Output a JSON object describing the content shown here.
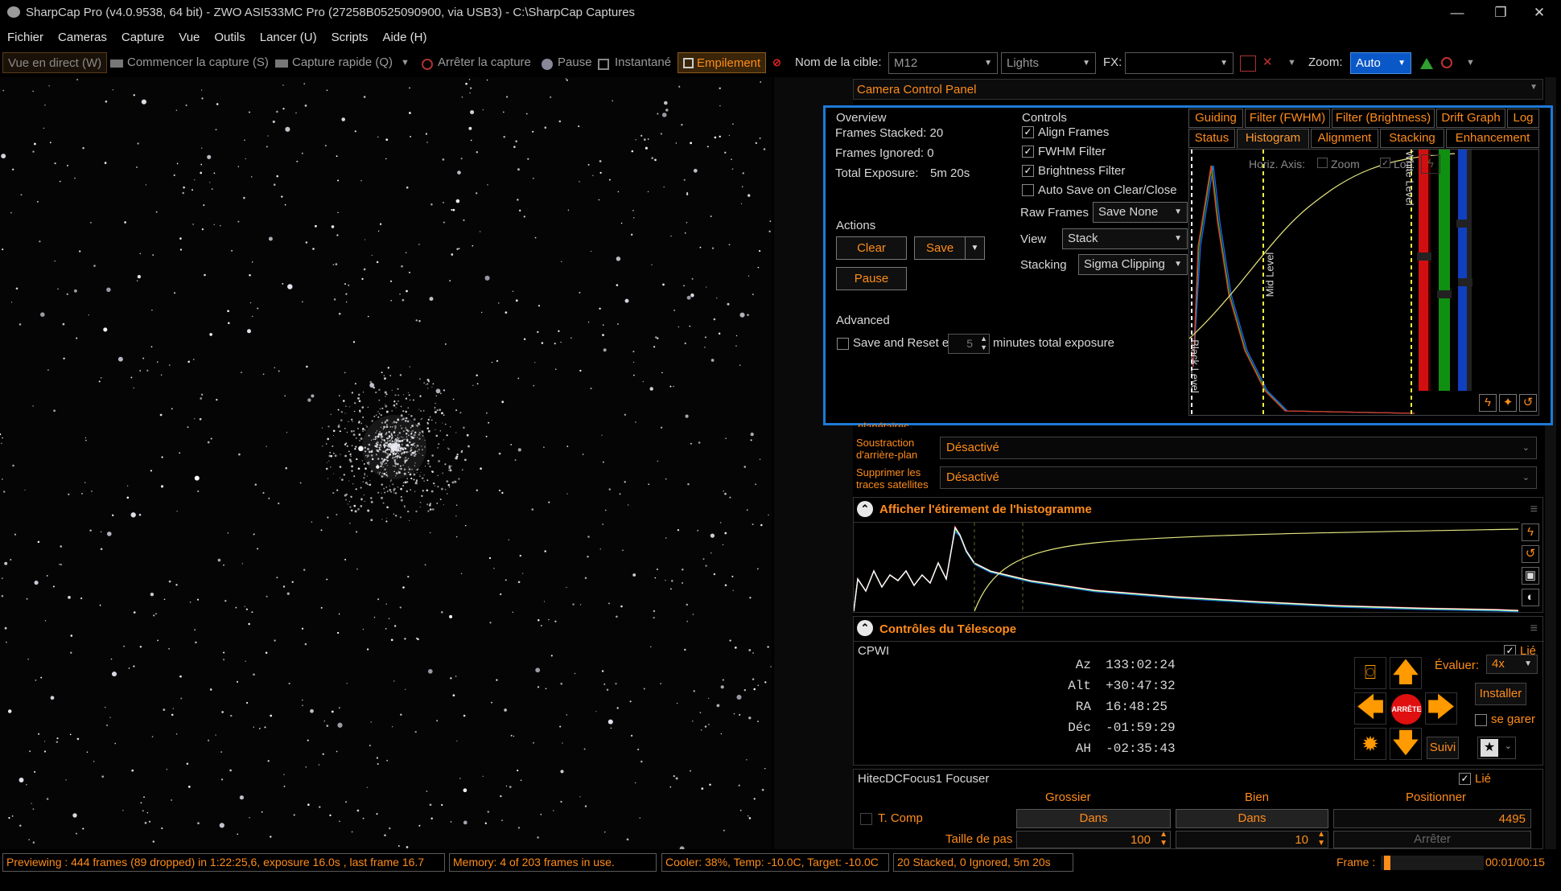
{
  "window": {
    "title": "SharpCap Pro (v4.0.9538, 64 bit) - ZWO ASI533MC Pro (27258B0525090900, via USB3) - C:\\SharpCap Captures",
    "minimize": "—",
    "restore": "❐",
    "close": "✕"
  },
  "menu": [
    "Fichier",
    "Cameras",
    "Capture",
    "Vue",
    "Outils",
    "Lancer (U)",
    "Scripts",
    "Aide (H)"
  ],
  "toolbar": {
    "live_view": "Vue en direct (W)",
    "start_capture": "Commencer la capture (S)",
    "quick_capture": "Capture rapide (Q)",
    "stop_capture": "Arrêter la capture",
    "pause": "Pause",
    "snapshot": "Instantané",
    "stack": "Empilement",
    "target_label": "Nom de la cible:",
    "target_value": "M12",
    "frame_type": "Lights",
    "fx_label": "FX:",
    "fx_value": "",
    "zoom_label": "Zoom:",
    "zoom_value": "Auto"
  },
  "colors": {
    "accent": "#ff8c1a",
    "highlight_border": "#1e7ad6",
    "stop_red": "#e01010",
    "arrow_orange": "#ff9a00"
  },
  "camera_panel": {
    "title": "Camera Control Panel"
  },
  "live_stack": {
    "overview": {
      "title": "Overview",
      "frames_stacked": "Frames Stacked: 20",
      "frames_ignored": "Frames Ignored: 0",
      "total_exposure_label": "Total Exposure:",
      "total_exposure_value": "5m 20s"
    },
    "actions": {
      "title": "Actions",
      "clear": "Clear",
      "save": "Save",
      "pause": "Pause"
    },
    "advanced": {
      "title": "Advanced",
      "save_reset": "Save and Reset every",
      "minutes_value": "5",
      "minutes_suffix": "minutes total exposure"
    },
    "controls": {
      "title": "Controls",
      "align_frames": "Align Frames",
      "fwhm_filter": "FWHM Filter",
      "brightness_filter": "Brightness Filter",
      "auto_save": "Auto Save on Clear/Close",
      "raw_frames_label": "Raw Frames",
      "raw_frames_value": "Save None",
      "view_label": "View",
      "view_value": "Stack",
      "stacking_label": "Stacking",
      "stacking_value": "Sigma Clipping"
    },
    "tabs_row1": [
      "Guiding",
      "Filter (FWHM)",
      "Filter (Brightness)",
      "Drift Graph",
      "Log"
    ],
    "tabs_row2": [
      "Status",
      "Histogram",
      "Alignment",
      "Stacking",
      "Enhancement"
    ],
    "histogram": {
      "horiz_axis": "Horiz. Axis:",
      "zoom": "Zoom",
      "log": "Log",
      "black_level": "Black Level",
      "mid_level": "Mid Level",
      "white_level": "White Level"
    }
  },
  "processing": {
    "partial_label": "planétaires",
    "bg_subtraction_label": "Soustraction d'arrière-plan",
    "bg_subtraction_value": "Désactivé",
    "satellite_label": "Supprimer les traces satellites",
    "satellite_value": "Désactivé"
  },
  "histogram_stretch": {
    "title": "Afficher l'étirement de l'histogramme"
  },
  "telescope": {
    "title": "Contrôles du Télescope",
    "mount": "CPWI",
    "linked": "Lié",
    "coords": [
      {
        "label": "Az",
        "value": "133:02:24"
      },
      {
        "label": "Alt",
        "value": "+30:47:32"
      },
      {
        "label": "RA",
        "value": "16:48:25"
      },
      {
        "label": "Déc",
        "value": "-01:59:29"
      },
      {
        "label": "AH",
        "value": "-02:35:43"
      }
    ],
    "stop": "ARRÊTE",
    "rate_label": "Évaluer:",
    "rate_value": "4x",
    "install": "Installer",
    "park": "se garer",
    "tracking": "Suivi"
  },
  "focuser": {
    "name": "HitecDCFocus1 Focuser",
    "linked": "Lié",
    "coarse": "Grossier",
    "fine": "Bien",
    "position_label": "Positionner",
    "t_comp": "T. Comp",
    "in_coarse": "Dans",
    "in_fine": "Dans",
    "position_value": "4495",
    "step_size": "Taille de pas",
    "coarse_step": "100",
    "fine_step": "10",
    "stop": "Arrêter"
  },
  "statusbar": {
    "preview": "Previewing : 444 frames (89 dropped) in 1:22:25,6, exposure 16.0s , last frame 16.7",
    "memory": "Memory: 4 of 203 frames in use.",
    "cooler": "Cooler: 38%, Temp: -10.0C, Target: -10.0C",
    "stacked": "20 Stacked, 0 Ignored, 5m 20s",
    "frame_label": "Frame :",
    "time": "00:01/00:15"
  }
}
